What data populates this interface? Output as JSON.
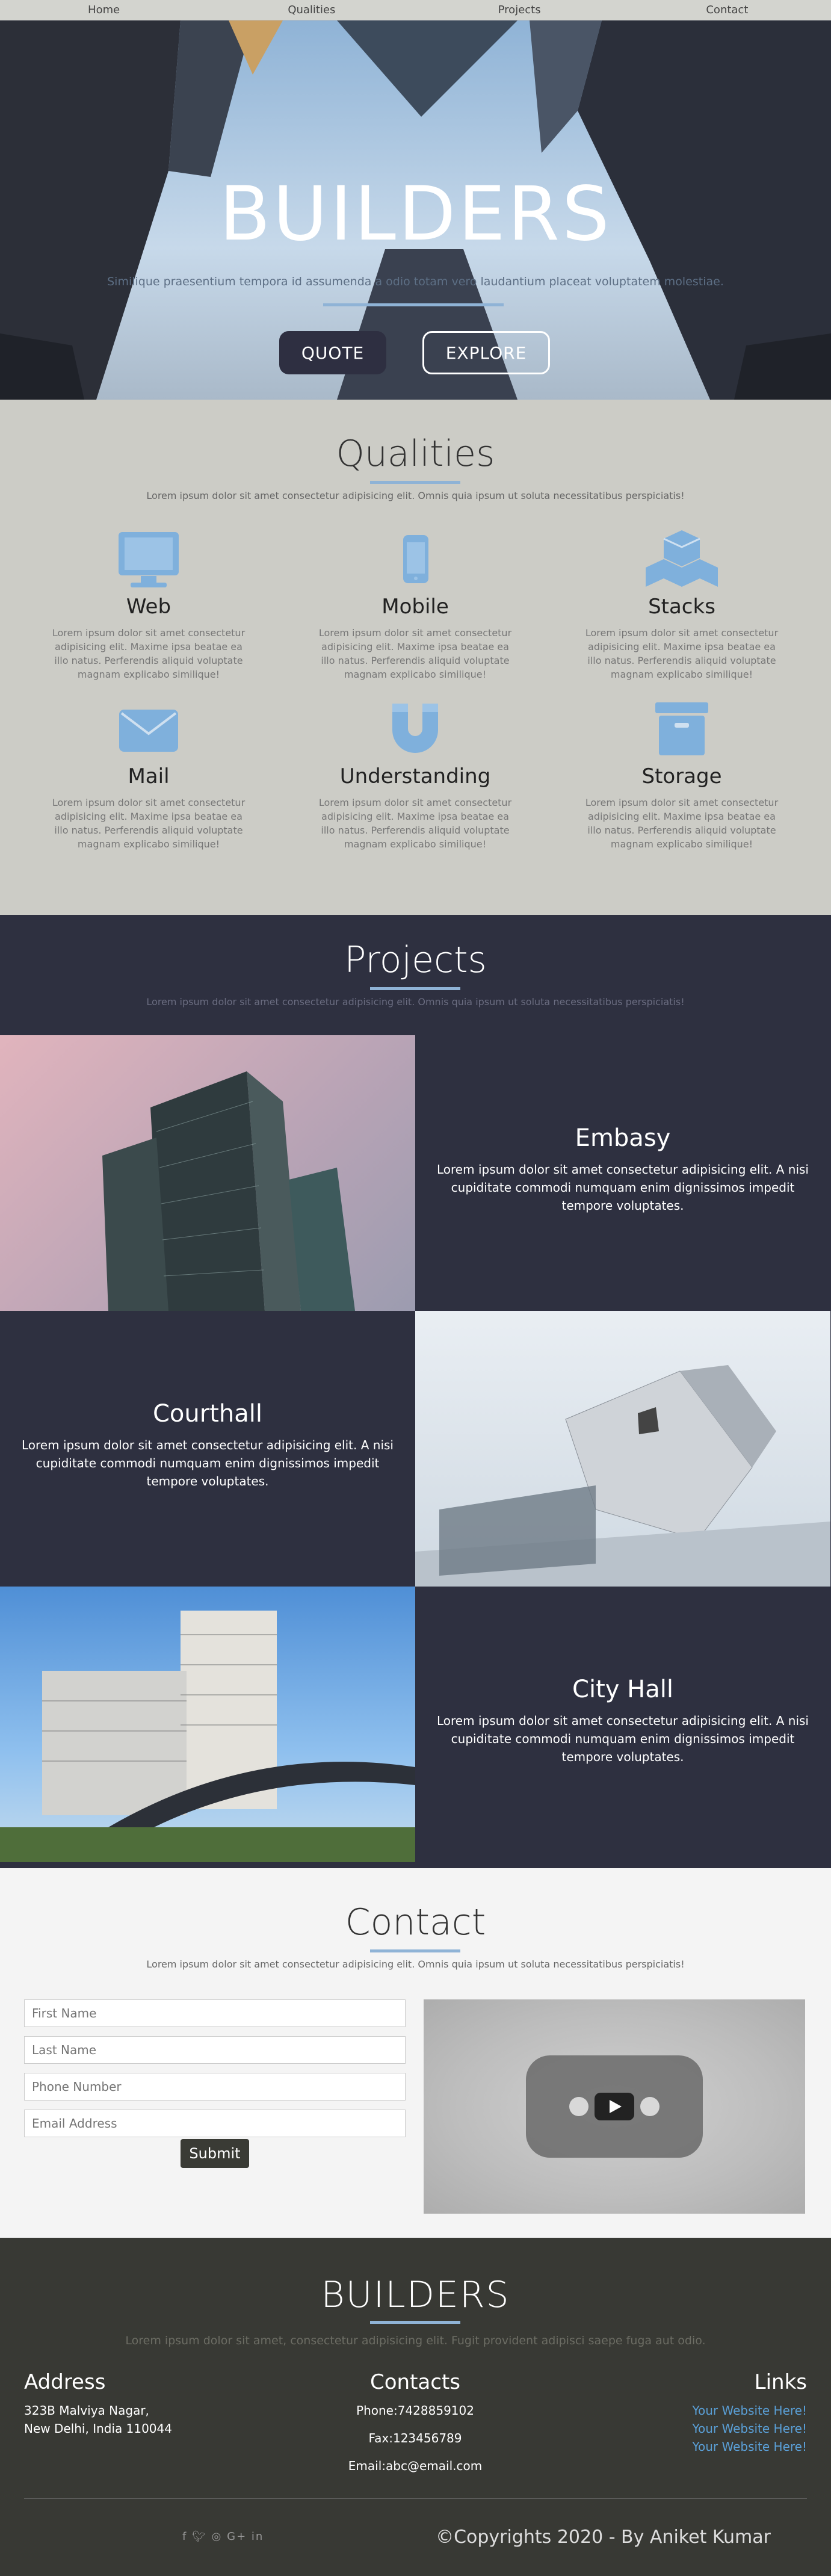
{
  "nav": {
    "items": [
      "Home",
      "Qualities",
      "Projects",
      "Contact"
    ]
  },
  "hero": {
    "title": "BUILDERS",
    "subtitle": "Similique praesentium tempora id assumenda a odio totam vero laudantium placeat voluptatem molestiae.",
    "quote_label": "QUOTE",
    "explore_label": "EXPLORE"
  },
  "qualities": {
    "title": "Qualities",
    "subtitle": "Lorem ipsum dolor sit amet consectetur adipisicing elit. Omnis quia ipsum ut soluta necessitatibus perspiciatis!",
    "items": [
      {
        "title": "Web",
        "icon": "desktop-icon",
        "text": "Lorem ipsum dolor sit amet consectetur adipisicing elit. Maxime ipsa beatae ea illo natus. Perferendis aliquid voluptate magnam explicabo similique!"
      },
      {
        "title": "Mobile",
        "icon": "mobile-icon",
        "text": "Lorem ipsum dolor sit amet consectetur adipisicing elit. Maxime ipsa beatae ea illo natus. Perferendis aliquid voluptate magnam explicabo similique!"
      },
      {
        "title": "Stacks",
        "icon": "cubes-icon",
        "text": "Lorem ipsum dolor sit amet consectetur adipisicing elit. Maxime ipsa beatae ea illo natus. Perferendis aliquid voluptate magnam explicabo similique!"
      },
      {
        "title": "Mail",
        "icon": "envelope-icon",
        "text": "Lorem ipsum dolor sit amet consectetur adipisicing elit. Maxime ipsa beatae ea illo natus. Perferendis aliquid voluptate magnam explicabo similique!"
      },
      {
        "title": "Understanding",
        "icon": "magnet-icon",
        "text": "Lorem ipsum dolor sit amet consectetur adipisicing elit. Maxime ipsa beatae ea illo natus. Perferendis aliquid voluptate magnam explicabo similique!"
      },
      {
        "title": "Storage",
        "icon": "archive-icon",
        "text": "Lorem ipsum dolor sit amet consectetur adipisicing elit. Maxime ipsa beatae ea illo natus. Perferendis aliquid voluptate magnam explicabo similique!"
      }
    ]
  },
  "projects": {
    "title": "Projects",
    "subtitle": "Lorem ipsum dolor sit amet consectetur adipisicing elit. Omnis quia ipsum ut soluta necessitatibus perspiciatis!",
    "items": [
      {
        "name": "Embasy",
        "text": "Lorem ipsum dolor sit amet consectetur adipisicing elit. A nisi cupiditate commodi numquam enim dignissimos impedit tempore voluptates."
      },
      {
        "name": "Courthall",
        "text": "Lorem ipsum dolor sit amet consectetur adipisicing elit. A nisi cupiditate commodi numquam enim dignissimos impedit tempore voluptates."
      },
      {
        "name": "City Hall",
        "text": "Lorem ipsum dolor sit amet consectetur adipisicing elit. A nisi cupiditate commodi numquam enim dignissimos impedit tempore voluptates."
      }
    ]
  },
  "contact": {
    "title": "Contact",
    "subtitle": "Lorem ipsum dolor sit amet consectetur adipisicing elit. Omnis quia ipsum ut soluta necessitatibus perspiciatis!",
    "first_name_placeholder": "First Name",
    "last_name_placeholder": "Last Name",
    "phone_placeholder": "Phone Number",
    "email_placeholder": "Email Address",
    "submit_label": "Submit"
  },
  "footer": {
    "brand": "BUILDERS",
    "subtitle": "Lorem ipsum dolor sit amet, consectetur adipisicing elit. Fugit provident adipisci saepe fuga aut odio.",
    "address_title": "Address",
    "address_line1": "323B Malviya Nagar,",
    "address_line2": "New Delhi, India 110044",
    "contacts_title": "Contacts",
    "phone": "Phone:7428859102",
    "fax": "Fax:123456789",
    "email": "Email:abc@email.com",
    "links_title": "Links",
    "links": [
      "Your Website Here!",
      "Your Website Here!",
      "Your Website Here!"
    ],
    "social_icons": [
      "facebook-icon",
      "twitter-icon",
      "instagram-icon",
      "google-plus-icon",
      "linkedin-icon"
    ],
    "copyright": "©Copyrights 2020 - By Aniket Kumar"
  },
  "colors": {
    "accent": "#8fb3d6",
    "dark": "#2e3040",
    "icon": "#7fb0dc",
    "link": "#5a9fd6"
  }
}
